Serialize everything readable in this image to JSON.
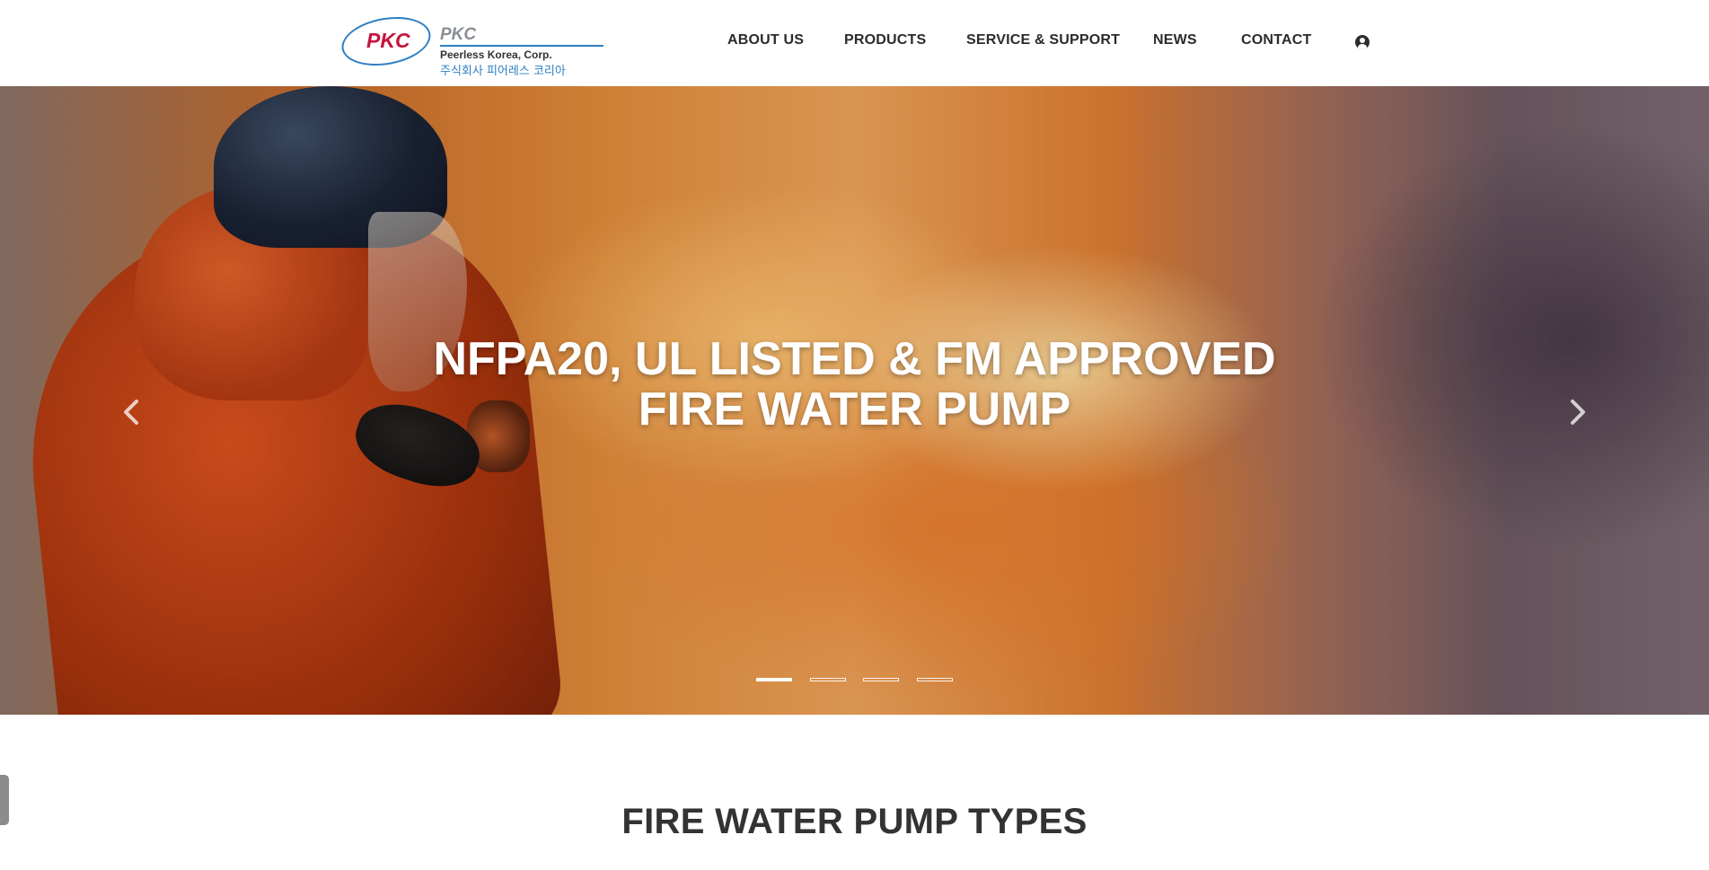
{
  "logo": {
    "mark": "PKC",
    "name": "PKC",
    "corp": "Peerless Korea, Corp.",
    "korean": "주식회사 피어레스 코리아"
  },
  "nav": {
    "items": [
      {
        "label": "ABOUT US"
      },
      {
        "label": "PRODUCTS"
      },
      {
        "label": "SERVICE & SUPPORT"
      },
      {
        "label": "NEWS"
      },
      {
        "label": "CONTACT"
      }
    ],
    "user_icon": "user-circle-icon"
  },
  "hero": {
    "title_line1": "NFPA20, UL LISTED & FM APPROVED",
    "title_line2": "FIRE WATER PUMP",
    "prev_icon": "chevron-left-icon",
    "next_icon": "chevron-right-icon",
    "slide_count": 4,
    "active_slide": 1
  },
  "section": {
    "title": "FIRE WATER PUMP TYPES"
  },
  "colors": {
    "brand_blue": "#2f7fc3",
    "brand_red": "#c4153c",
    "text_dark": "#2b2b2b"
  }
}
